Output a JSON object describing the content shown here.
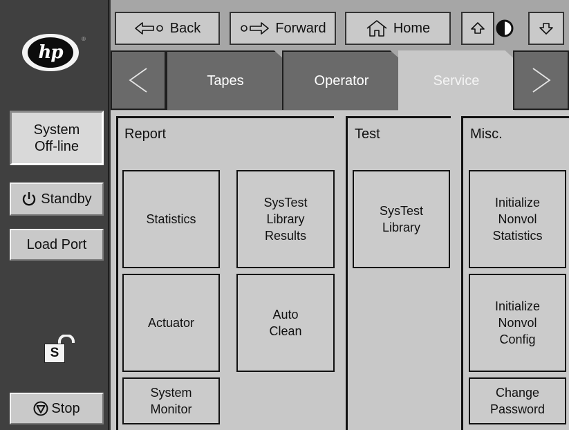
{
  "toolbar": {
    "back_label": "Back",
    "forward_label": "Forward",
    "home_label": "Home"
  },
  "sidebar": {
    "status_label": "System\nOff-line",
    "standby_label": "Standby",
    "load_port_label": "Load Port",
    "lock_letter": "S",
    "stop_label": "Stop",
    "logo_text": "hp",
    "logo_mark": "®"
  },
  "tabs": {
    "items": [
      {
        "label": "Tapes"
      },
      {
        "label": "Operator"
      },
      {
        "label": "Service",
        "active": true
      }
    ]
  },
  "sections": {
    "report": {
      "title": "Report",
      "buttons": {
        "statistics": "Statistics",
        "systest_results": "SysTest\nLibrary\nResults",
        "actuator": "Actuator",
        "auto_clean": "Auto\nClean",
        "system_monitor": "System\nMonitor"
      }
    },
    "test": {
      "title": "Test",
      "buttons": {
        "systest_library": "SysTest\nLibrary"
      }
    },
    "misc": {
      "title": "Misc.",
      "buttons": {
        "init_nonvol_stats": "Initialize\nNonvol\nStatistics",
        "init_nonvol_config": "Initialize\nNonvol\nConfig",
        "change_password": "Change\nPassword"
      }
    }
  },
  "icons": {
    "back": "left-arrow-icon",
    "forward": "right-arrow-icon",
    "home": "home-icon",
    "scroll_up": "up-arrow-icon",
    "contrast": "contrast-icon",
    "scroll_down": "down-arrow-icon",
    "tab_prev": "tab-left-arrow-icon",
    "tab_next": "tab-right-arrow-icon",
    "power": "power-icon",
    "stop": "stop-icon",
    "lock": "unlocked-padlock-icon"
  },
  "colors": {
    "sidebar_bg": "#404040",
    "toolbar_bg": "#a6a6a6",
    "button_bg": "#c9c9c9",
    "dark_tab": "#6a6a6a",
    "content_bg": "#c8c8c8"
  }
}
